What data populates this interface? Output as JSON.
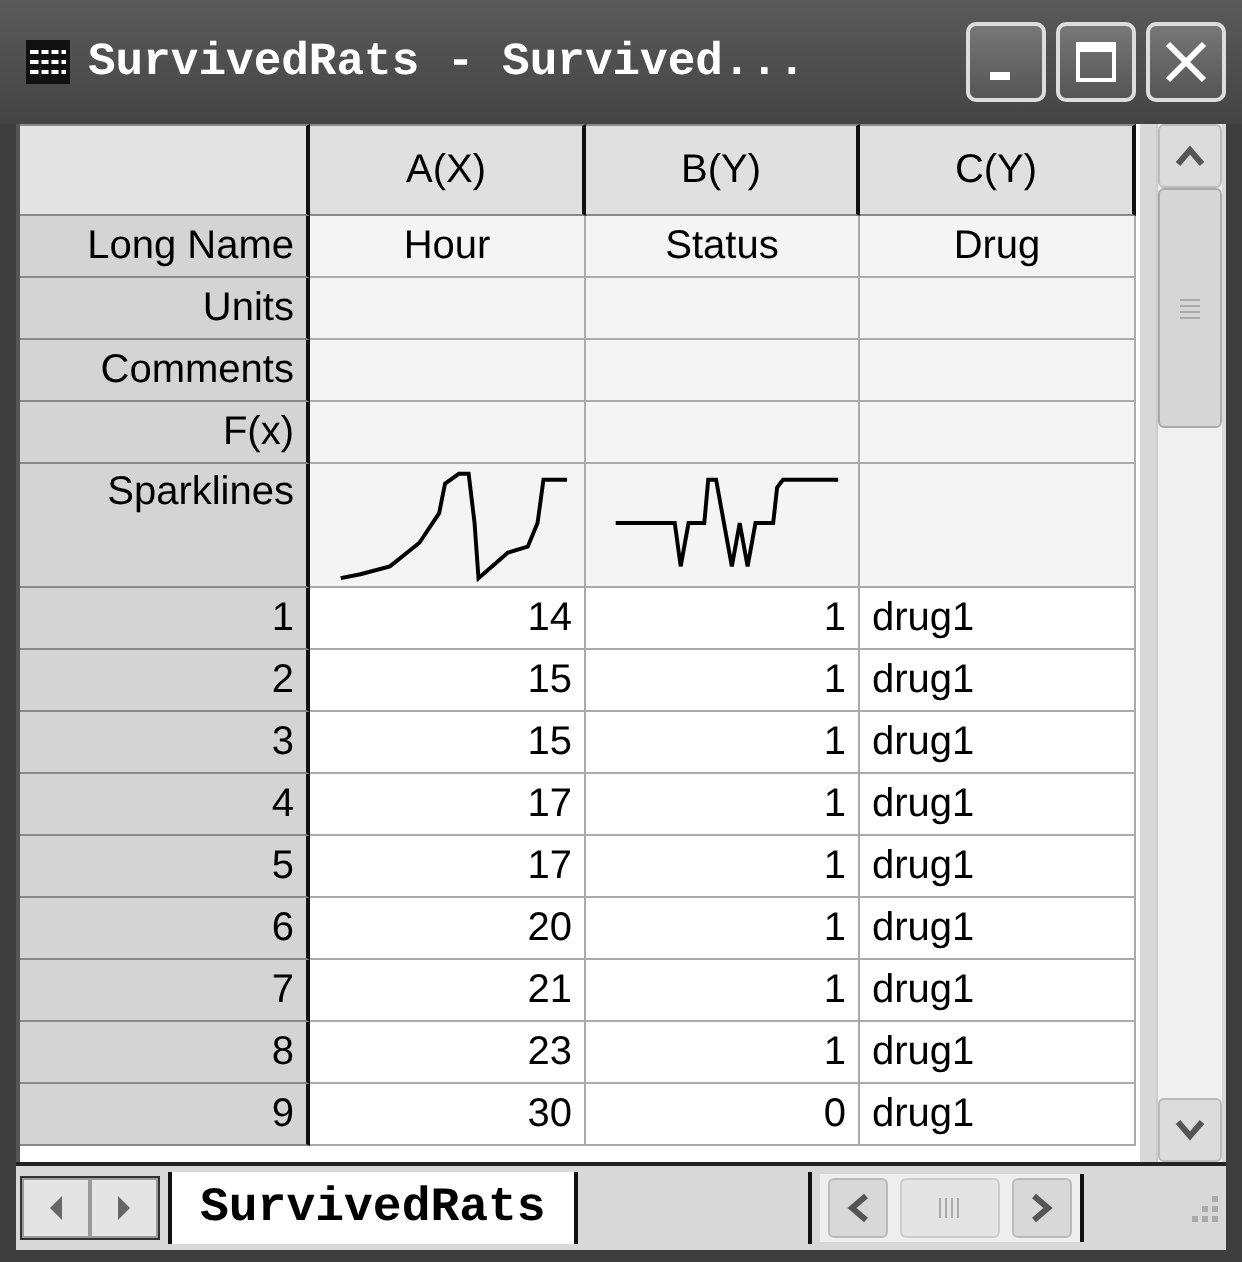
{
  "window": {
    "title": "SurvivedRats - Survived..."
  },
  "table": {
    "columns": [
      {
        "label": "A(X)",
        "sparkline": true
      },
      {
        "label": "B(Y)",
        "sparkline": true
      },
      {
        "label": "C(Y)",
        "sparkline": false
      }
    ],
    "label_rows": [
      {
        "label": "Long Name",
        "kind": "text",
        "cells": [
          "Hour",
          "Status",
          "Drug"
        ]
      },
      {
        "label": "Units",
        "kind": "text"
      },
      {
        "label": "Comments",
        "kind": "text"
      },
      {
        "label": "F(x)",
        "kind": "text"
      },
      {
        "label": "Sparklines",
        "kind": "sparklines"
      }
    ],
    "rows": [
      {
        "number": "1",
        "cells": [
          "14",
          "1",
          "drug1"
        ]
      },
      {
        "number": "2",
        "cells": [
          "15",
          "1",
          "drug1"
        ]
      },
      {
        "number": "3",
        "cells": [
          "15",
          "1",
          "drug1"
        ]
      },
      {
        "number": "4",
        "cells": [
          "17",
          "1",
          "drug1"
        ]
      },
      {
        "number": "5",
        "cells": [
          "17",
          "1",
          "drug1"
        ]
      },
      {
        "number": "6",
        "cells": [
          "20",
          "1",
          "drug1"
        ]
      },
      {
        "number": "7",
        "cells": [
          "21",
          "1",
          "drug1"
        ]
      },
      {
        "number": "8",
        "cells": [
          "23",
          "1",
          "drug1"
        ]
      },
      {
        "number": "9",
        "cells": [
          "30",
          "0",
          "drug1"
        ]
      }
    ]
  },
  "sheet_tabs": [
    {
      "label": "SurvivedRats",
      "selected": true
    }
  ]
}
